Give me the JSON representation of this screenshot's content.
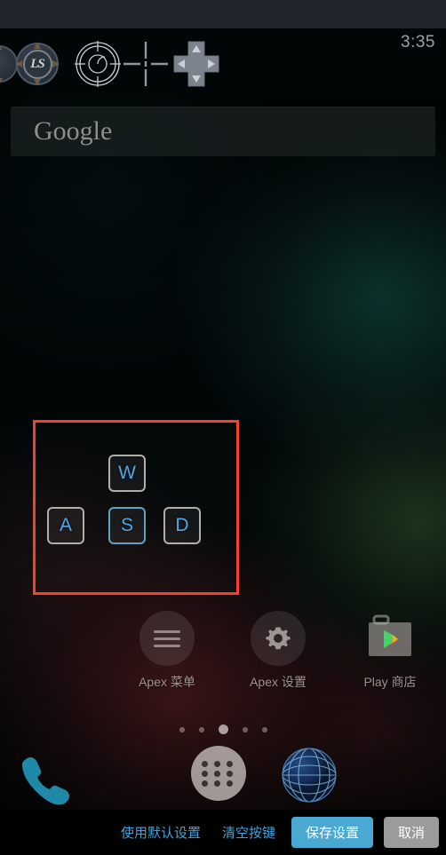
{
  "status_bar": {
    "clock": "3:35"
  },
  "gamepad_toolbar": {
    "icons": [
      {
        "name": "dpad-partial-icon",
        "label": ""
      },
      {
        "name": "left-stick-icon",
        "label": "LS"
      },
      {
        "name": "target-reticle-icon",
        "label": ""
      },
      {
        "name": "crosshair-icon",
        "label": ""
      },
      {
        "name": "dpad-icon",
        "label": ""
      }
    ]
  },
  "search_widget": {
    "brand": "Google",
    "placeholder": "Google"
  },
  "key_mapping": {
    "keys": [
      {
        "label": "W",
        "selected": false
      },
      {
        "label": "A",
        "selected": false
      },
      {
        "label": "S",
        "selected": true
      },
      {
        "label": "D",
        "selected": false
      }
    ],
    "selection_color": "#f4402e",
    "key_text_color": "#4ea7e8",
    "key_border_color": "#b4aeab",
    "key_selected_border_color": "#5fa3c0"
  },
  "home_screen": {
    "apps": [
      {
        "label": "Apex 菜单",
        "icon": "menu-icon"
      },
      {
        "label": "Apex 设置",
        "icon": "gear-icon"
      },
      {
        "label": "Play 商店",
        "icon": "play-store-icon"
      }
    ],
    "page_dots": {
      "count": 5,
      "active_index": 2
    },
    "dock": [
      {
        "label": "Phone",
        "icon": "phone-icon"
      },
      {
        "label": "Apps",
        "icon": "app-drawer-icon"
      },
      {
        "label": "Browser",
        "icon": "globe-icon"
      }
    ]
  },
  "action_bar": {
    "use_default_label": "使用默认设置",
    "clear_keys_label": "清空按键",
    "save_label": "保存设置",
    "cancel_label": "取消",
    "link_color": "#3ba3e0",
    "save_color": "#4aa9d2",
    "cancel_color": "#9b9b9b"
  }
}
